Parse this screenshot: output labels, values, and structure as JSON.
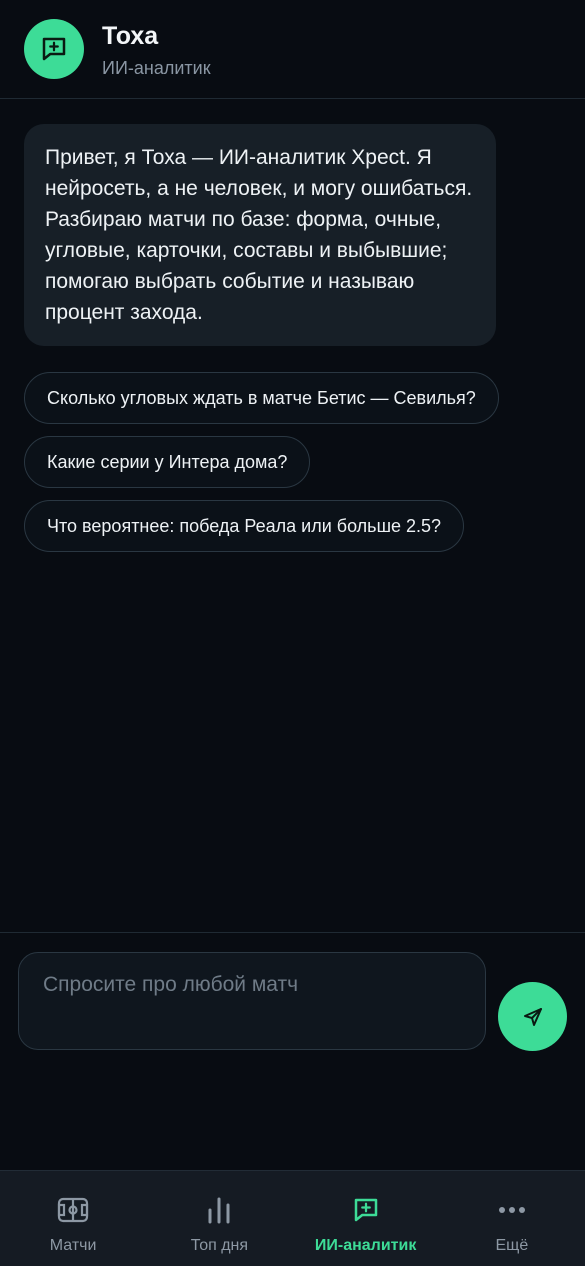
{
  "header": {
    "title": "Тоха",
    "subtitle": "ИИ-аналитик",
    "avatar_icon": "chat-sparkle-icon"
  },
  "chat": {
    "greeting": "Привет, я Тоха — ИИ-аналитик Xpect. Я нейросеть, а не человек, и могу ошибаться. Разбираю матчи по базе: форма, очные, угловые, карточки, составы и выбывшие; помогаю выбрать событие и называю процент захода.",
    "suggestions": [
      "Сколько угловых ждать в матче Бетис — Севилья?",
      "Какие серии у Интера дома?",
      "Что вероятнее: победа Реала или больше 2.5?"
    ]
  },
  "composer": {
    "placeholder": "Спросите про любой матч",
    "value": "",
    "send_icon": "send-icon"
  },
  "nav": {
    "items": [
      {
        "label": "Матчи",
        "icon": "field-icon",
        "active": false
      },
      {
        "label": "Топ дня",
        "icon": "bar-chart-icon",
        "active": false
      },
      {
        "label": "ИИ-аналитик",
        "icon": "chat-sparkle-icon",
        "active": true
      },
      {
        "label": "Ещё",
        "icon": "more-dots-icon",
        "active": false
      }
    ]
  },
  "colors": {
    "accent": "#3ddc97",
    "background": "#080c12",
    "bubble": "#171f27",
    "nav_background": "#151b23"
  }
}
